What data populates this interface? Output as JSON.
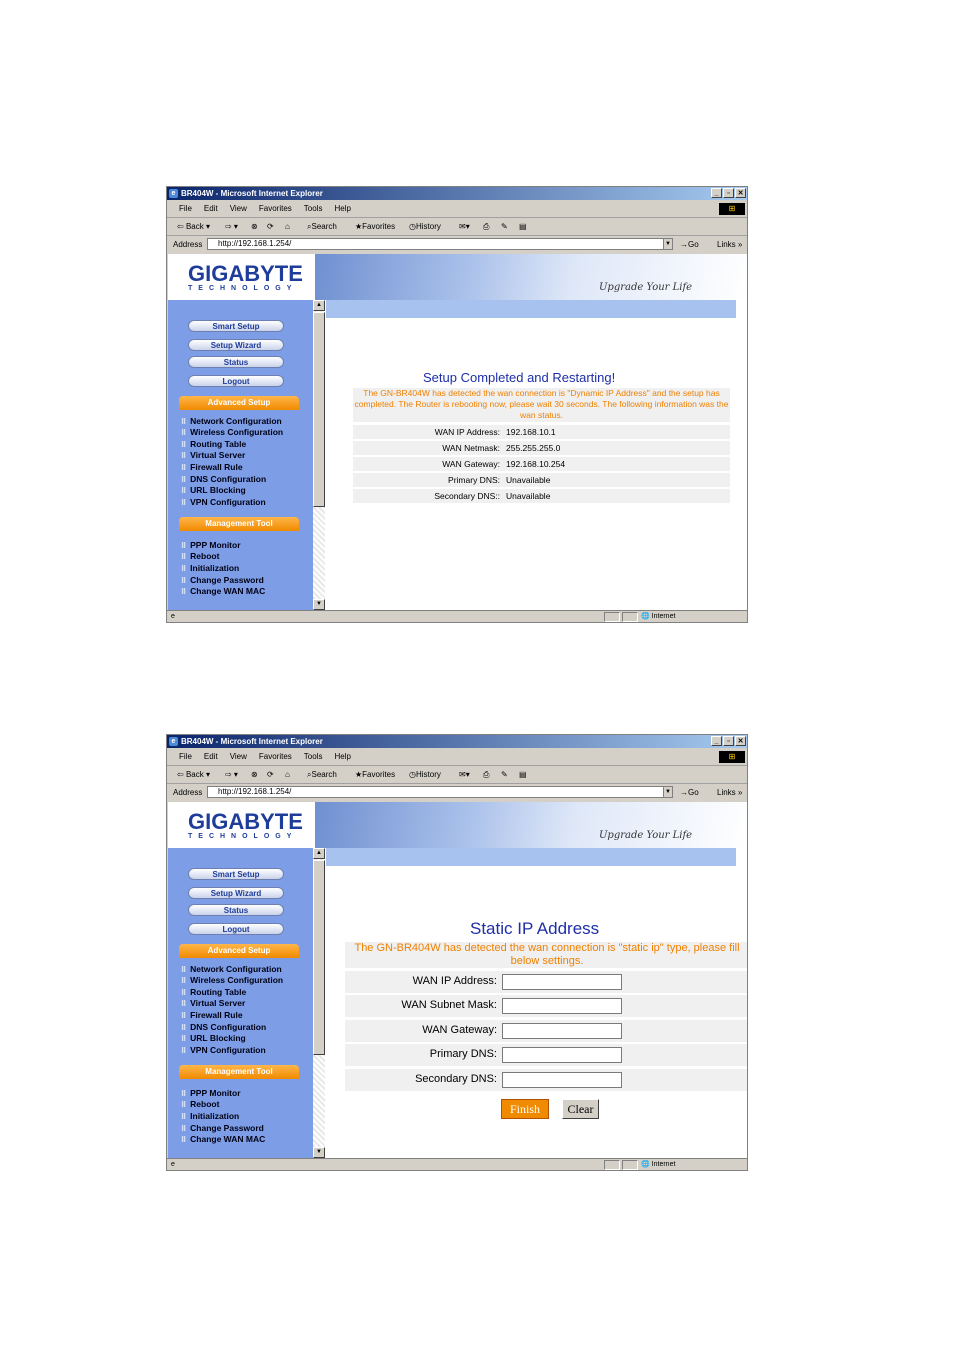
{
  "browser": {
    "window_title": "BR404W - Microsoft Internet Explorer",
    "menu": [
      "File",
      "Edit",
      "View",
      "Favorites",
      "Tools",
      "Help"
    ],
    "toolbar": {
      "back": "Back",
      "search": "Search",
      "favorites": "Favorites",
      "history": "History"
    },
    "address_label": "Address",
    "url": "http://192.168.1.254/",
    "go": "Go",
    "links": "Links",
    "status_zone": "Internet"
  },
  "brand": {
    "name": "GIGABYTE",
    "sub": "TECHNOLOGY",
    "slogan": "Upgrade Your Life"
  },
  "sidebar": {
    "buttons": [
      "Smart Setup",
      "Setup Wizard",
      "Status",
      "Logout"
    ],
    "advanced_title": "Advanced Setup",
    "advanced_items": [
      "Network Configuration",
      "Wireless Configuration",
      "Routing Table",
      "Virtual Server",
      "Firewall Rule",
      "DNS Configuration",
      "URL Blocking",
      "VPN Configuration"
    ],
    "management_title": "Management Tool",
    "management_items": [
      "PPP Monitor",
      "Reboot",
      "Initialization",
      "Change Password",
      "Change WAN MAC"
    ]
  },
  "screen1": {
    "title": "Setup Completed and Restarting!",
    "notice": "The GN-BR404W has detected the wan connection is \"Dynamic IP Address\" and the setup has completed. The Router is rebooting now, please wait 30 seconds. The following information was the wan status.",
    "rows": [
      {
        "label": "WAN IP Address:",
        "value": "192.168.10.1"
      },
      {
        "label": "WAN Netmask:",
        "value": "255.255.255.0"
      },
      {
        "label": "WAN Gateway:",
        "value": "192.168.10.254"
      },
      {
        "label": "Primary DNS:",
        "value": "Unavailable"
      },
      {
        "label": "Secondary DNS::",
        "value": "Unavailable"
      }
    ]
  },
  "screen2": {
    "title": "Static IP Address",
    "notice": "The GN-BR404W has detected the wan connection is \"static ip\" type, please fill below settings.",
    "fields": [
      {
        "label": "WAN IP Address:",
        "value": ""
      },
      {
        "label": "WAN Subnet Mask:",
        "value": ""
      },
      {
        "label": "WAN Gateway:",
        "value": ""
      },
      {
        "label": "Primary DNS:",
        "value": ""
      },
      {
        "label": "Secondary DNS:",
        "value": ""
      }
    ],
    "finish_label": "Finish",
    "clear_label": "Clear"
  }
}
